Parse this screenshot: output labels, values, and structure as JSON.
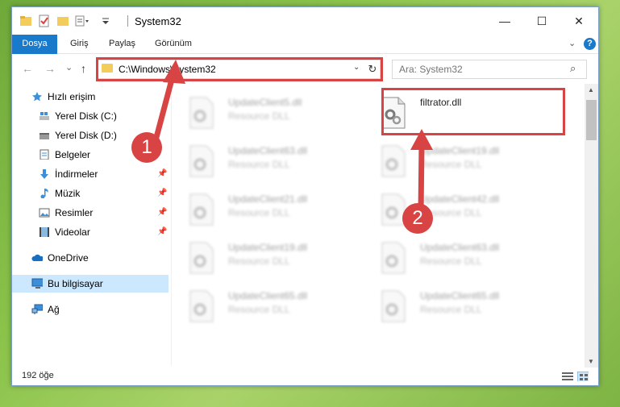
{
  "window": {
    "title": "System32",
    "minimize_glyph": "—",
    "maximize_glyph": "☐",
    "close_glyph": "✕"
  },
  "ribbon": {
    "tabs": [
      "Dosya",
      "Giriş",
      "Paylaş",
      "Görünüm"
    ],
    "collapse_glyph": "⌄",
    "help_glyph": "?"
  },
  "nav": {
    "back_glyph": "←",
    "forward_glyph": "→",
    "recent_glyph": "⌄",
    "up_glyph": "↑",
    "address": "C:\\Windows\\System32",
    "address_dropdown_glyph": "⌄",
    "refresh_glyph": "↻",
    "search_placeholder": "Ara: System32",
    "search_icon_glyph": "⌕"
  },
  "sidebar": {
    "items": [
      {
        "label": "Hızlı erişim",
        "icon": "star-icon",
        "pinned": false
      },
      {
        "label": "Yerel Disk (C:)",
        "icon": "drive-icon",
        "pinned": false
      },
      {
        "label": "Yerel Disk (D:)",
        "icon": "drive-icon",
        "pinned": false
      },
      {
        "label": "Belgeler",
        "icon": "documents-icon",
        "pinned": false
      },
      {
        "label": "İndirmeler",
        "icon": "download-icon",
        "pinned": true
      },
      {
        "label": "Müzik",
        "icon": "music-icon",
        "pinned": true
      },
      {
        "label": "Resimler",
        "icon": "pictures-icon",
        "pinned": true
      },
      {
        "label": "Videolar",
        "icon": "videos-icon",
        "pinned": true
      },
      {
        "label": "OneDrive",
        "icon": "cloud-icon",
        "pinned": false
      },
      {
        "label": "Bu bilgisayar",
        "icon": "computer-icon",
        "pinned": false,
        "selected": true
      },
      {
        "label": "Ağ",
        "icon": "network-icon",
        "pinned": false
      }
    ],
    "pin_glyph": "📌"
  },
  "files": {
    "left": [
      {
        "name": "UpdateClient5.dll",
        "type": "Resource DLL"
      },
      {
        "name": "UpdateClient63.dll",
        "type": "Resource DLL"
      },
      {
        "name": "UpdateClient21.dll",
        "type": "Resource DLL"
      },
      {
        "name": "UpdateClient19.dll",
        "type": "Resource DLL"
      },
      {
        "name": "UpdateClient65.dll",
        "type": "Resource DLL"
      }
    ],
    "right": [
      {
        "name": "filtrator.dll",
        "type": ""
      },
      {
        "name": "UpdateClient19.dll",
        "type": "Resource DLL"
      },
      {
        "name": "UpdateClient42.dll",
        "type": "Resource DLL"
      },
      {
        "name": "UpdateClient63.dll",
        "type": "Resource DLL"
      },
      {
        "name": "UpdateClient65.dll",
        "type": "Resource DLL"
      }
    ]
  },
  "status": {
    "item_count": "192 öğe"
  },
  "annotations": {
    "step1": "1",
    "step2": "2",
    "color": "#d84343"
  }
}
